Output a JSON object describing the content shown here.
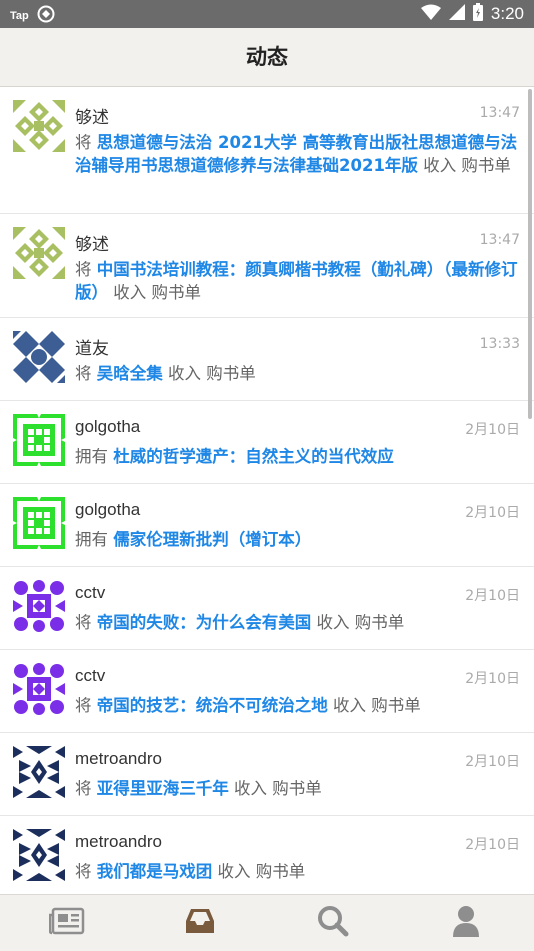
{
  "status": {
    "app_label": "Tap",
    "time": "3:20"
  },
  "header": {
    "title": "动态"
  },
  "feed": [
    {
      "user": "够述",
      "time": "13:47",
      "verb": "将",
      "book": "思想道德与法治 2021大学 高等教育出版社思想道德与法治辅导用书思想道德修养与法律基础2021年版",
      "suffix": "收入 购书单",
      "avatar_color": "#a8bf62"
    },
    {
      "user": "够述",
      "time": "13:47",
      "verb": "将",
      "book": "中国书法培训教程：颜真卿楷书教程（勤礼碑）（最新修订版）",
      "suffix": "收入 购书单",
      "avatar_color": "#a8bf62"
    },
    {
      "user": "道友",
      "time": "13:33",
      "verb": "将",
      "book": "吴晗全集",
      "suffix": "收入 购书单",
      "avatar_color": "#3d5e94"
    },
    {
      "user": "golgotha",
      "time": "2月10日",
      "verb": "拥有",
      "book": "杜威的哲学遗产：自然主义的当代效应",
      "suffix": "",
      "avatar_color": "#2ee02e"
    },
    {
      "user": "golgotha",
      "time": "2月10日",
      "verb": "拥有",
      "book": "儒家伦理新批判（增订本）",
      "suffix": "",
      "avatar_color": "#2ee02e"
    },
    {
      "user": "cctv",
      "time": "2月10日",
      "verb": "将",
      "book": "帝国的失败：为什么会有美国",
      "suffix": "收入 购书单",
      "avatar_color": "#7a2ee8"
    },
    {
      "user": "cctv",
      "time": "2月10日",
      "verb": "将",
      "book": "帝国的技艺：统治不可统治之地",
      "suffix": "收入 购书单",
      "avatar_color": "#7a2ee8"
    },
    {
      "user": "metroandro",
      "time": "2月10日",
      "verb": "将",
      "book": "亚得里亚海三千年",
      "suffix": "收入 购书单",
      "avatar_color": "#1c2f5c"
    },
    {
      "user": "metroandro",
      "time": "2月10日",
      "verb": "将",
      "book": "我们都是马戏团",
      "suffix": "收入 购书单",
      "avatar_color": "#1c2f5c"
    }
  ],
  "tabs": [
    {
      "icon": "newspaper-icon",
      "active": false
    },
    {
      "icon": "inbox-icon",
      "active": true
    },
    {
      "icon": "search-icon",
      "active": false
    },
    {
      "icon": "user-icon",
      "active": false
    }
  ],
  "colors": {
    "accent": "#1f87e5",
    "tab_active": "#7a5a3c",
    "tab_inactive": "#8e8e8e"
  }
}
